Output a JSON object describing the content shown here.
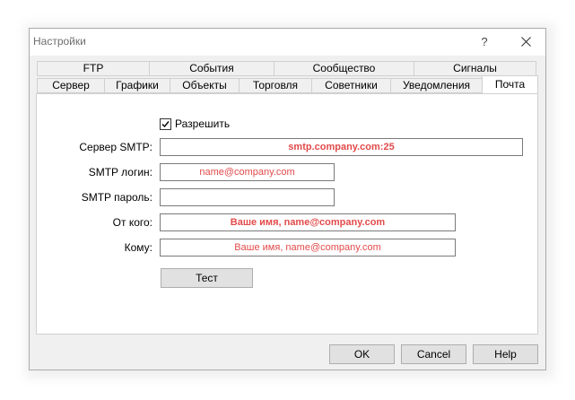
{
  "window": {
    "title": "Настройки",
    "help_symbol": "?"
  },
  "tabs_row1": [
    "FTP",
    "События",
    "Сообщество",
    "Сигналы"
  ],
  "tabs_row2": [
    "Сервер",
    "Графики",
    "Объекты",
    "Торговля",
    "Советники",
    "Уведомления",
    "Почта"
  ],
  "form": {
    "enable_label": "Разрешить",
    "enable_checked": true,
    "server_label": "Сервер SMTP:",
    "server_placeholder": "smtp.company.com:25",
    "login_label": "SMTP логин:",
    "login_placeholder": "name@company.com",
    "password_label": "SMTP пароль:",
    "from_label": "От кого:",
    "from_placeholder": "Ваше имя, name@company.com",
    "to_label": "Кому:",
    "to_placeholder": "Ваше имя, name@company.com",
    "test_button": "Тест"
  },
  "buttons": {
    "ok": "OK",
    "cancel": "Cancel",
    "help": "Help"
  },
  "colors": {
    "placeholder": "#e34a4a",
    "window_bg": "#f0f0f0"
  },
  "icons": {
    "close": "close-icon",
    "check": "check-icon"
  }
}
